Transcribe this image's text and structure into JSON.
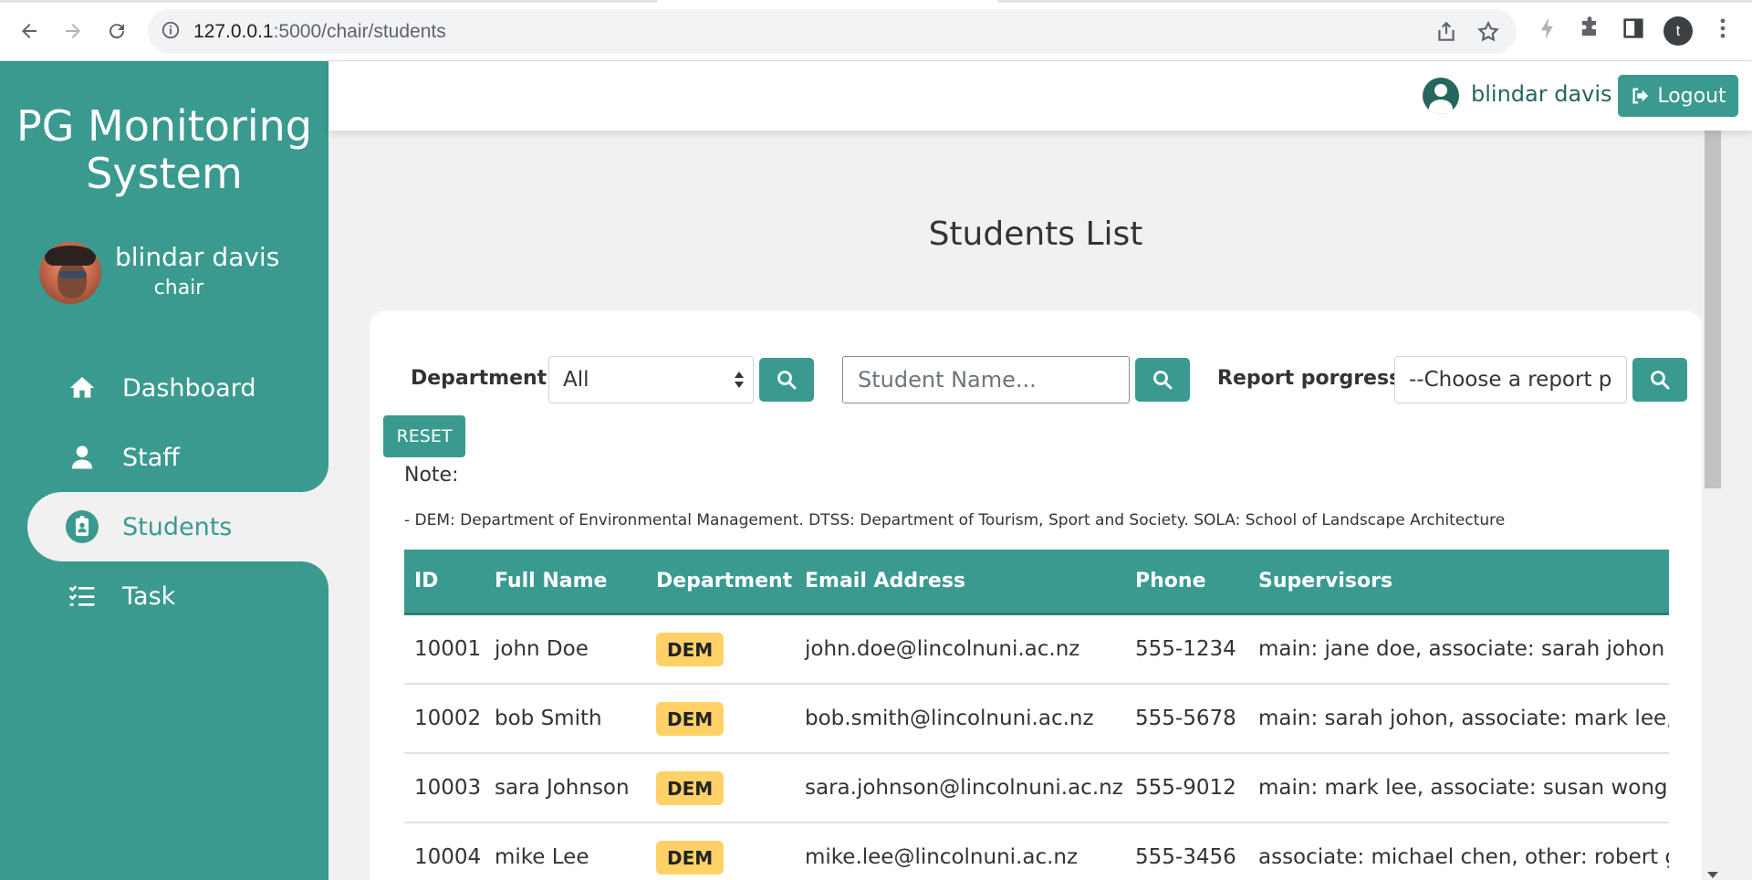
{
  "browser": {
    "url_host": "127.0.0.1",
    "url_rest": ":5000/chair/students",
    "profile_initial": "t"
  },
  "sidebar": {
    "brand_line1": "PG Monitoring",
    "brand_line2": "System",
    "user_name": "blindar davis",
    "user_role": "chair",
    "items": [
      {
        "label": "Dashboard",
        "icon": "home-icon"
      },
      {
        "label": "Staff",
        "icon": "person-icon"
      },
      {
        "label": "Students",
        "icon": "student-badge-icon"
      },
      {
        "label": "Task",
        "icon": "task-list-icon"
      }
    ],
    "active_index": 2
  },
  "topbar": {
    "username": "blindar davis",
    "logout_label": "Logout"
  },
  "main": {
    "title": "Students List",
    "filters": {
      "department_label": "Department:",
      "department_value": "All",
      "student_placeholder": "Student Name...",
      "report_label": "Report porgress:",
      "report_value": "--Choose a report p",
      "reset_label": "RESET"
    },
    "note_label": "Note:",
    "note_text": "- DEM: Department of Environmental Management. DTSS: Department of Tourism, Sport and Society. SOLA: School of Landscape Architecture",
    "table": {
      "headers": [
        "ID",
        "Full Name",
        "Department",
        "Email Address",
        "Phone",
        "Supervisors"
      ],
      "rows": [
        {
          "id": "10001",
          "name": "john Doe",
          "dept": "DEM",
          "email": "john.doe@lincolnuni.ac.nz",
          "phone": "555-1234",
          "supervisors": "main: jane doe, associate: sarah johon"
        },
        {
          "id": "10002",
          "name": "bob Smith",
          "dept": "DEM",
          "email": "bob.smith@lincolnuni.ac.nz",
          "phone": "555-5678",
          "supervisors": "main: sarah johon, associate: mark lee, o"
        },
        {
          "id": "10003",
          "name": "sara Johnson",
          "dept": "DEM",
          "email": "sara.johnson@lincolnuni.ac.nz",
          "phone": "555-9012",
          "supervisors": "main: mark lee, associate: susan wong, o"
        },
        {
          "id": "10004",
          "name": "mike Lee",
          "dept": "DEM",
          "email": "mike.lee@lincolnuni.ac.nz",
          "phone": "555-3456",
          "supervisors": "associate: michael chen, other: robert go"
        }
      ]
    }
  },
  "colors": {
    "primary": "#3a9a8f",
    "badge": "#ffd166",
    "background": "#f0f1f0"
  }
}
